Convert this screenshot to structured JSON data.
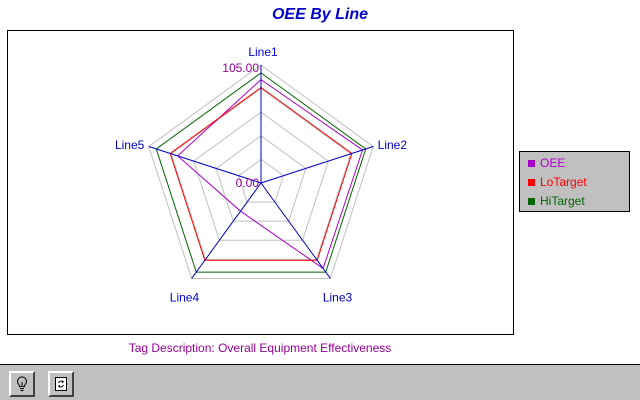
{
  "window": {
    "title": "OEE By Line"
  },
  "footer": {
    "tag_description": "Tag Description: Overall Equipment Effectiveness"
  },
  "toolbar": {
    "buttons": [
      {
        "icon": "lightbulb-icon"
      },
      {
        "icon": "refresh-icon"
      }
    ]
  },
  "colors": {
    "title": "#0000cc",
    "axis": "#0000cc",
    "grid": "#c0c0c0",
    "scale_label": "#990099"
  },
  "chart_data": {
    "type": "radar",
    "title": "OEE By Line",
    "categories": [
      "Line1",
      "Line2",
      "Line3",
      "Line4",
      "Line5"
    ],
    "scale": {
      "min": 0,
      "max": 105,
      "min_label": "0.00",
      "max_label": "105.00"
    },
    "grid_rings": 5,
    "grid": true,
    "legend_position": "right",
    "series": [
      {
        "name": "OEE",
        "color": "#aa00cc",
        "values": [
          92,
          95,
          94,
          31,
          78
        ]
      },
      {
        "name": "LoTarget",
        "color": "#ff0000",
        "values": [
          85,
          85,
          85,
          85,
          85
        ]
      },
      {
        "name": "HiTarget",
        "color": "#006600",
        "values": [
          98,
          98,
          98,
          98,
          98
        ]
      }
    ]
  }
}
